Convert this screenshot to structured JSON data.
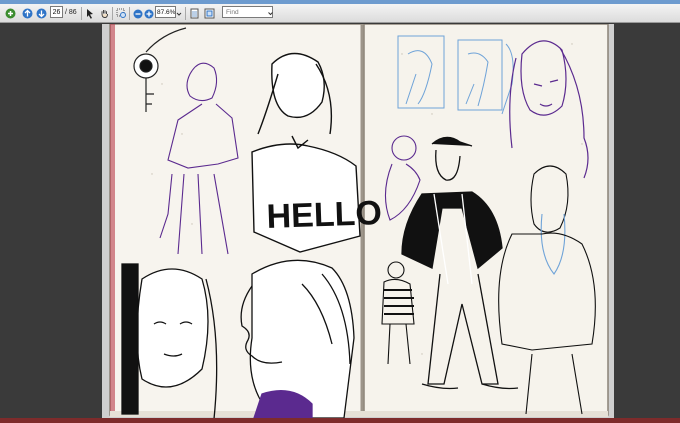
{
  "toolbar": {
    "page_current": "26",
    "page_total": "/ 86",
    "zoom": "87.6%",
    "find_placeholder": "Find"
  },
  "sketch_text": {
    "shirt_word": "HELLO"
  },
  "colors": {
    "accent": "#6d9bcf",
    "ink_purple": "#5b2a8f",
    "ink_blue": "#6fa3d8",
    "paper": "#f7f4ee"
  }
}
